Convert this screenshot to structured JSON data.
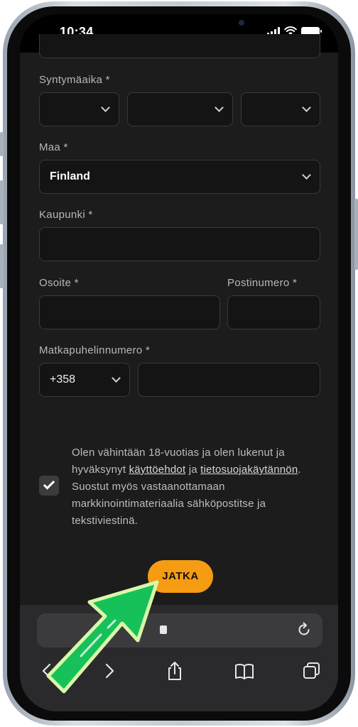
{
  "status_bar": {
    "time": "10:34"
  },
  "form": {
    "birthdate": {
      "label": "Syntymäaika *"
    },
    "country": {
      "label": "Maa *",
      "value": "Finland"
    },
    "city": {
      "label": "Kaupunki *",
      "value": ""
    },
    "address": {
      "label": "Osoite *",
      "value": ""
    },
    "postal_code": {
      "label": "Postinumero *",
      "value": ""
    },
    "phone": {
      "label": "Matkapuhelinnumero *",
      "country_code": "+358",
      "value": ""
    }
  },
  "consent": {
    "checked": true,
    "text_1": "Olen vähintään 18-vuotias ja olen lukenut ja hyväksynyt ",
    "link_terms": "käyttöehdot",
    "text_2": " ja ",
    "link_privacy": "tietosuojakäytännön",
    "text_3": ". Suostut myös vastaanottamaan markkinointimateriaalia sähköpostitse ja tekstiviestinä."
  },
  "cta": {
    "label": "JATKA"
  },
  "colors": {
    "accent": "#f59c12",
    "background": "#1c1c1d",
    "field": "#141415",
    "arrow": "#16c15a"
  },
  "icons": [
    "back-icon",
    "forward-icon",
    "share-icon",
    "bookmarks-icon",
    "tabs-icon",
    "reload-icon",
    "lock-icon"
  ]
}
